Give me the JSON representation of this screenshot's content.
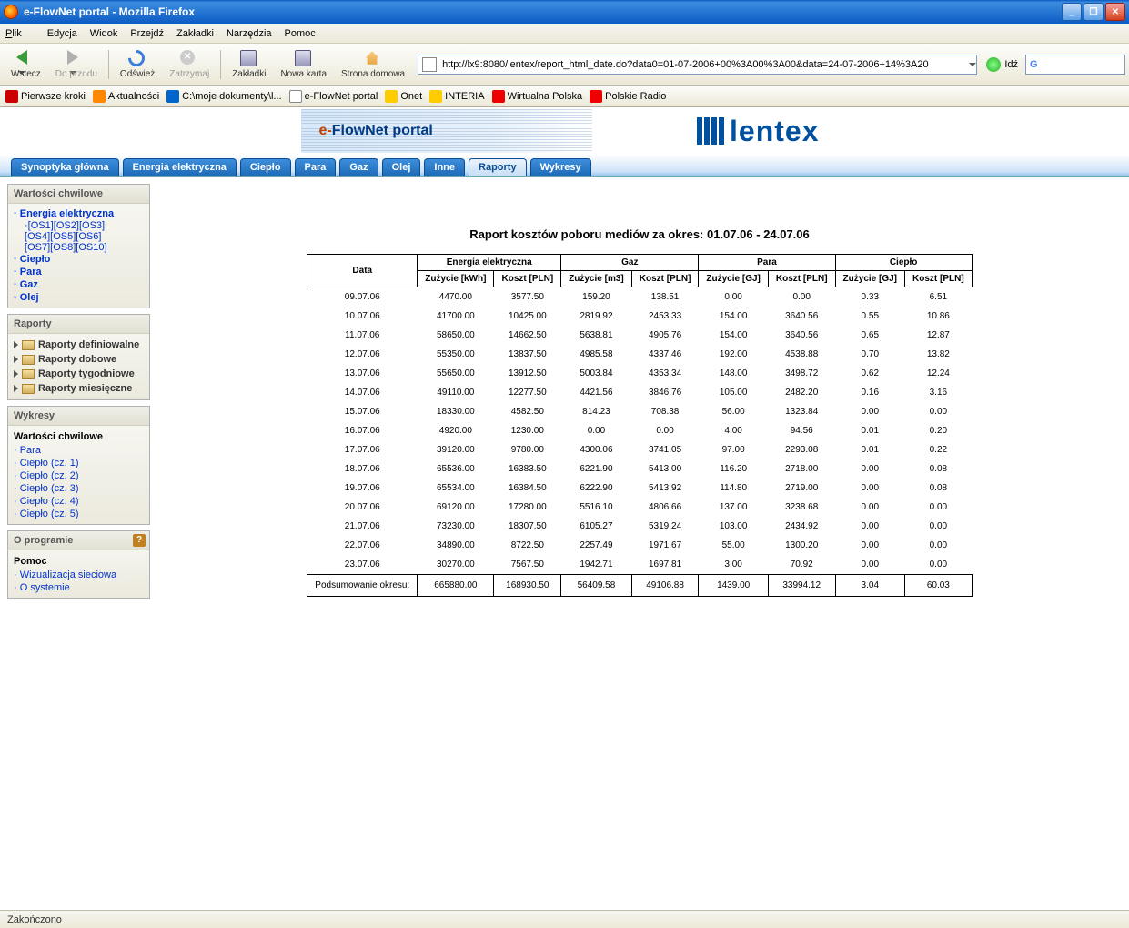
{
  "window": {
    "title": "e-FlowNet portal - Mozilla Firefox"
  },
  "menu": {
    "file": "Plik",
    "edit": "Edycja",
    "view": "Widok",
    "go": "Przejdź",
    "bookmarks": "Zakładki",
    "tools": "Narzędzia",
    "help": "Pomoc"
  },
  "nav": {
    "back": "Wstecz",
    "forward": "Do przodu",
    "reload": "Odśwież",
    "stop": "Zatrzymaj",
    "bookmarks": "Zakładki",
    "newtab": "Nowa karta",
    "home": "Strona domowa",
    "url": "http://lx9:8080/lentex/report_html_date.do?data0=01-07-2006+00%3A00%3A00&data=24-07-2006+14%3A20",
    "go": "Idź"
  },
  "bmbar": [
    "Pierwsze kroki",
    "Aktualności",
    "C:\\moje dokumenty\\l...",
    "e-FlowNet portal",
    "Onet",
    "INTERIA",
    "Wirtualna Polska",
    "Polskie Radio"
  ],
  "banner": {
    "e": "e-",
    "flownet": "FlowNet",
    "portal": " portal",
    "logo": "lentex"
  },
  "tabs": [
    "Synoptyka główna",
    "Energia elektryczna",
    "Ciepło",
    "Para",
    "Gaz",
    "Olej",
    "Inne",
    "Raporty",
    "Wykresy"
  ],
  "tabs_active_index": 7,
  "sidebar": {
    "box1_title": "Wartości chwilowe",
    "box1_main_link": "Energia elektryczna",
    "box1_os": [
      "OS1",
      "OS2",
      "OS3",
      "OS4",
      "OS5",
      "OS6",
      "OS7",
      "OS8",
      "OS10"
    ],
    "box1_links": [
      "Ciepło",
      "Para",
      "Gaz",
      "Olej"
    ],
    "box2_title": "Raporty",
    "box2_items": [
      "Raporty definiowalne",
      "Raporty dobowe",
      "Raporty tygodniowe",
      "Raporty miesięczne"
    ],
    "box3_title": "Wykresy",
    "box3_subtitle": "Wartości chwilowe",
    "box3_links": [
      "Para",
      "Ciepło (cz. 1)",
      "Ciepło (cz. 2)",
      "Ciepło (cz. 3)",
      "Ciepło (cz. 4)",
      "Ciepło (cz. 5)"
    ],
    "box4_title": "O programie",
    "box4_subtitle": "Pomoc",
    "box4_links": [
      "Wizualizacja sieciowa",
      "O systemie"
    ]
  },
  "report": {
    "title": "Raport kosztów poboru mediów za okres: 01.07.06 - 24.07.06",
    "h_data": "Data",
    "groups": [
      "Energia elektryczna",
      "Gaz",
      "Para",
      "Ciepło"
    ],
    "sub_z_kwh": "Zużycie [kWh]",
    "sub_k": "Koszt [PLN]",
    "sub_z_m3": "Zużycie [m3]",
    "sub_z_gj": "Zużycie [GJ]",
    "rows": [
      [
        "09.07.06",
        "4470.00",
        "3577.50",
        "159.20",
        "138.51",
        "0.00",
        "0.00",
        "0.33",
        "6.51"
      ],
      [
        "10.07.06",
        "41700.00",
        "10425.00",
        "2819.92",
        "2453.33",
        "154.00",
        "3640.56",
        "0.55",
        "10.86"
      ],
      [
        "11.07.06",
        "58650.00",
        "14662.50",
        "5638.81",
        "4905.76",
        "154.00",
        "3640.56",
        "0.65",
        "12.87"
      ],
      [
        "12.07.06",
        "55350.00",
        "13837.50",
        "4985.58",
        "4337.46",
        "192.00",
        "4538.88",
        "0.70",
        "13.82"
      ],
      [
        "13.07.06",
        "55650.00",
        "13912.50",
        "5003.84",
        "4353.34",
        "148.00",
        "3498.72",
        "0.62",
        "12.24"
      ],
      [
        "14.07.06",
        "49110.00",
        "12277.50",
        "4421.56",
        "3846.76",
        "105.00",
        "2482.20",
        "0.16",
        "3.16"
      ],
      [
        "15.07.06",
        "18330.00",
        "4582.50",
        "814.23",
        "708.38",
        "56.00",
        "1323.84",
        "0.00",
        "0.00"
      ],
      [
        "16.07.06",
        "4920.00",
        "1230.00",
        "0.00",
        "0.00",
        "4.00",
        "94.56",
        "0.01",
        "0.20"
      ],
      [
        "17.07.06",
        "39120.00",
        "9780.00",
        "4300.06",
        "3741.05",
        "97.00",
        "2293.08",
        "0.01",
        "0.22"
      ],
      [
        "18.07.06",
        "65536.00",
        "16383.50",
        "6221.90",
        "5413.00",
        "116.20",
        "2718.00",
        "0.00",
        "0.08"
      ],
      [
        "19.07.06",
        "65534.00",
        "16384.50",
        "6222.90",
        "5413.92",
        "114.80",
        "2719.00",
        "0.00",
        "0.08"
      ],
      [
        "20.07.06",
        "69120.00",
        "17280.00",
        "5516.10",
        "4806.66",
        "137.00",
        "3238.68",
        "0.00",
        "0.00"
      ],
      [
        "21.07.06",
        "73230.00",
        "18307.50",
        "6105.27",
        "5319.24",
        "103.00",
        "2434.92",
        "0.00",
        "0.00"
      ],
      [
        "22.07.06",
        "34890.00",
        "8722.50",
        "2257.49",
        "1971.67",
        "55.00",
        "1300.20",
        "0.00",
        "0.00"
      ],
      [
        "23.07.06",
        "30270.00",
        "7567.50",
        "1942.71",
        "1697.81",
        "3.00",
        "70.92",
        "0.00",
        "0.00"
      ]
    ],
    "footer_label": "Podsumowanie okresu:",
    "footer": [
      "665880.00",
      "168930.50",
      "56409.58",
      "49106.88",
      "1439.00",
      "33994.12",
      "3.04",
      "60.03"
    ]
  },
  "status": "Zakończono"
}
